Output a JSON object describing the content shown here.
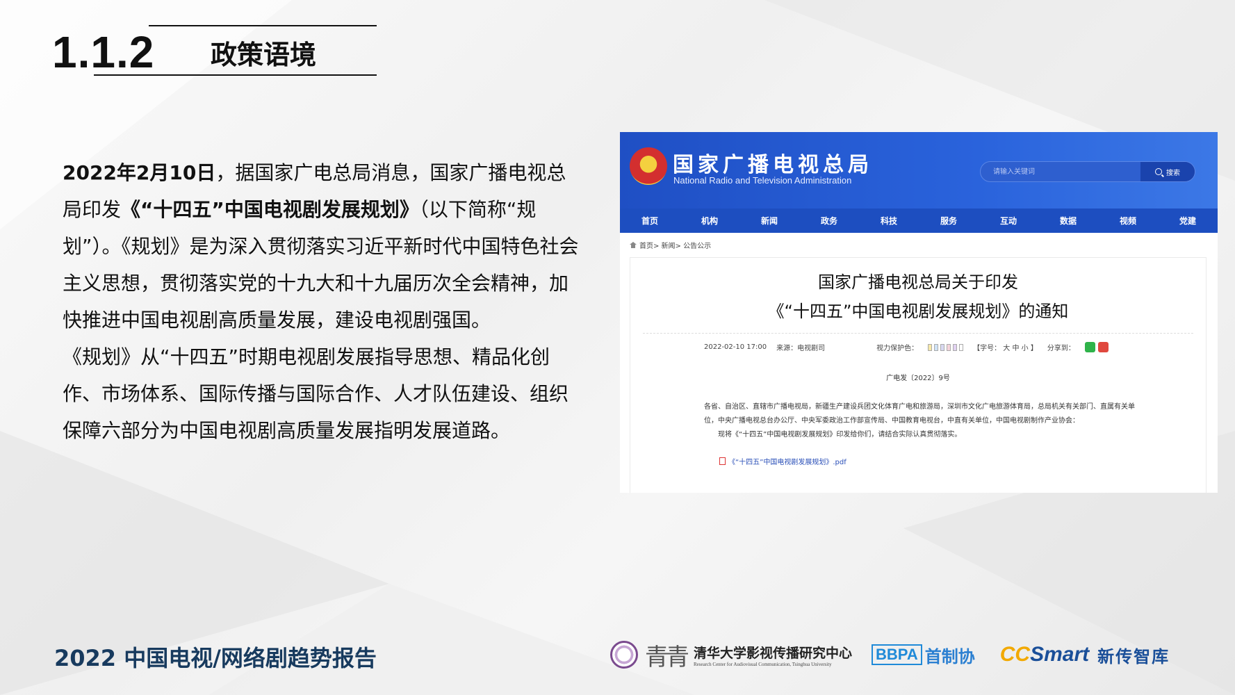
{
  "header": {
    "section_number": "1.1.2",
    "section_title": "政策语境"
  },
  "body": {
    "p1_lead": "2022年2月10日",
    "p1_a": "，据国家广电总局消息，国家广播电视总局印发",
    "p1_bold": "《“十四五”中国电视剧发展规划》",
    "p1_b": "（以下简称“规划”）。《规划》是为深入贯彻落实习近平新时代中国特色社会主义思想，贯彻落实党的十九大和十九届历次全会精神，加快推进中国电视剧高质量发展，建设电视剧强国。",
    "p2": "《规划》从“十四五”时期电视剧发展指导思想、精品化创作、市场体系、国际传播与国际合作、人才队伍建设、组织保障六部分为中国电视剧高质量发展指明发展道路。"
  },
  "screenshot": {
    "site_title": "国家广播电视总局",
    "site_subtitle": "National Radio and Television Administration",
    "search_placeholder": "请输入关键词",
    "search_button": "搜索",
    "nav": [
      "首页",
      "机构",
      "新闻",
      "政务",
      "科技",
      "服务",
      "互动",
      "数据",
      "视频",
      "党建"
    ],
    "breadcrumb": "首页> 新闻> 公告公示",
    "article_title_1": "国家广播电视总局关于印发",
    "article_title_2": "《“十四五”中国电视剧发展规划》的通知",
    "date": "2022-02-10 17:00",
    "source": "来源：电视剧司",
    "vision_label": "视力保护色：",
    "font_size_label": "【字号： 大 中 小 】",
    "share_label": "分享到：",
    "doc_number": "广电发〔2022〕9号",
    "body_line_1": "各省、自治区、直辖市广播电视局，新疆生产建设兵团文化体育广电和旅游局，深圳市文化广电旅游体育局，总局机关有关部门、直属有关单位，中央广播电视总台办公厅、中央军委政治工作部宣传局、中国教育电视台，中直有关单位，中国电视剧制作产业协会：",
    "body_line_2": "现将《“十四五”中国电视剧发展规划》印发给你们，请结合实际认真贯彻落实。",
    "attachment": "《“十四五”中国电视剧发展规划》.pdf",
    "swatch_colors": [
      "#f7e9a8",
      "#cfe3f7",
      "#d8d8f2",
      "#f6d4dc",
      "#e2d2f2",
      "#ffffff"
    ]
  },
  "footer": {
    "report_title": "2022 中国电视/网络剧趋势报告",
    "logo_qing": "青青",
    "tsinghua_cn": "清华大学影视传播研究中心",
    "tsinghua_en": "Research Center for Audiovisual Communication, Tsinghua University",
    "bbpa": "BBPA",
    "bbpa_cn": "首制协",
    "cc_c": "CC",
    "cc_smart": "Smart",
    "cc_cn": "新传智库"
  }
}
